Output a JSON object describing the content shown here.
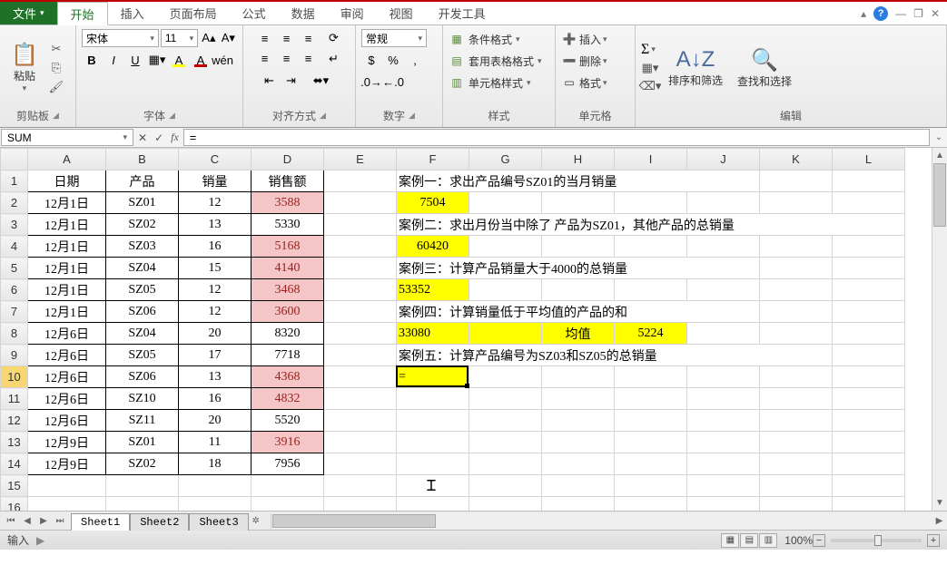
{
  "tabs": {
    "file": "文件",
    "home": "开始",
    "insert": "插入",
    "layout": "页面布局",
    "formula": "公式",
    "data": "数据",
    "review": "审阅",
    "view": "视图",
    "dev": "开发工具"
  },
  "ribbon": {
    "clipboard": {
      "paste": "粘贴",
      "label": "剪贴板"
    },
    "font": {
      "name": "宋体",
      "size": "11",
      "label": "字体"
    },
    "align": {
      "label": "对齐方式"
    },
    "number": {
      "format": "常规",
      "label": "数字"
    },
    "styles": {
      "cond": "条件格式",
      "table": "套用表格格式",
      "cell": "单元格样式",
      "label": "样式"
    },
    "cells": {
      "insert": "插入",
      "delete": "删除",
      "format": "格式",
      "label": "单元格"
    },
    "editing": {
      "sort": "排序和筛选",
      "find": "查找和选择",
      "label": "编辑"
    }
  },
  "nameBox": "SUM",
  "formula": "=",
  "columns": [
    "A",
    "B",
    "C",
    "D",
    "E",
    "F",
    "G",
    "H",
    "I",
    "J",
    "K",
    "L"
  ],
  "headers": {
    "A": "日期",
    "B": "产品",
    "C": "销量",
    "D": "销售额"
  },
  "rows": [
    {
      "A": "12月1日",
      "B": "SZ01",
      "C": "12",
      "D": "3588",
      "pink": true
    },
    {
      "A": "12月1日",
      "B": "SZ02",
      "C": "13",
      "D": "5330",
      "pink": false
    },
    {
      "A": "12月1日",
      "B": "SZ03",
      "C": "16",
      "D": "5168",
      "pink": true
    },
    {
      "A": "12月1日",
      "B": "SZ04",
      "C": "15",
      "D": "4140",
      "pink": true
    },
    {
      "A": "12月1日",
      "B": "SZ05",
      "C": "12",
      "D": "3468",
      "pink": true
    },
    {
      "A": "12月1日",
      "B": "SZ06",
      "C": "12",
      "D": "3600",
      "pink": true
    },
    {
      "A": "12月6日",
      "B": "SZ04",
      "C": "20",
      "D": "8320",
      "pink": false
    },
    {
      "A": "12月6日",
      "B": "SZ05",
      "C": "17",
      "D": "7718",
      "pink": false
    },
    {
      "A": "12月6日",
      "B": "SZ06",
      "C": "13",
      "D": "4368",
      "pink": true
    },
    {
      "A": "12月6日",
      "B": "SZ10",
      "C": "16",
      "D": "4832",
      "pink": true
    },
    {
      "A": "12月6日",
      "B": "SZ11",
      "C": "20",
      "D": "5520",
      "pink": false
    },
    {
      "A": "12月9日",
      "B": "SZ01",
      "C": "11",
      "D": "3916",
      "pink": true
    },
    {
      "A": "12月9日",
      "B": "SZ02",
      "C": "18",
      "D": "7956",
      "pink": false
    }
  ],
  "cases": {
    "c1": "案例一：求出产品编号SZ01的当月销量",
    "v1": "7504",
    "c2": "案例二：求出月份当中除了 产品为SZ01，其他产品的总销量",
    "v2": "60420",
    "c3": "案例三：计算产品销量大于4000的总销量",
    "v3": "53352",
    "c4": "案例四：计算销量低于平均值的产品的和",
    "v4": "33080",
    "avg_lbl": "均值",
    "avg": "5224",
    "c5": "案例五：计算产品编号为SZ03和SZ05的总销量",
    "v5": "="
  },
  "sheets": [
    "Sheet1",
    "Sheet2",
    "Sheet3"
  ],
  "status": {
    "mode": "输入",
    "zoom": "100%"
  }
}
